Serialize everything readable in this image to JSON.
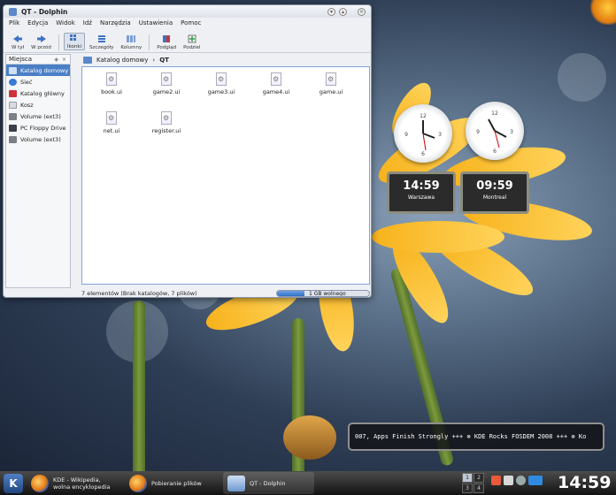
{
  "window": {
    "title": "QT - Dolphin",
    "menu": [
      "Plik",
      "Edycja",
      "Widok",
      "Idź",
      "Narzędzia",
      "Ustawienia",
      "Pomoc"
    ],
    "toolbar": [
      {
        "label": "W tył"
      },
      {
        "label": "W przód"
      },
      {
        "label": "Ikonki"
      },
      {
        "label": "Szczegóły"
      },
      {
        "label": "Kolumny"
      },
      {
        "label": "Podgląd"
      },
      {
        "label": "Podziel"
      }
    ],
    "sidebar": {
      "title": "Miejsca",
      "items": [
        "Katalog domowy",
        "Sieć",
        "Katalog główny",
        "Kosz",
        "Volume (ext3)",
        "PC Floppy Drive",
        "Volume (ext3)"
      ]
    },
    "breadcrumb": {
      "root": "Katalog domowy",
      "separator": "›",
      "current": "QT"
    },
    "files": [
      "book.ui",
      "game2.ui",
      "game3.ui",
      "game4.ui",
      "game.ui",
      "net.ui",
      "register.ui"
    ],
    "status": {
      "text": "7 elementów (Brak katalogów, 7 plików)",
      "disk_label": "1 GB wolnego",
      "disk_used_fraction": 0.3
    }
  },
  "clocks": {
    "digital": [
      {
        "time": "14:59",
        "city": "Warszawa"
      },
      {
        "time": "09:59",
        "city": "Montreal"
      }
    ]
  },
  "ticker": {
    "text": "007, Apps Finish Strongly +++ ⊗ KDE Rocks FOSDEM 2008 +++ ⊗ Ko"
  },
  "taskbar": {
    "tasks": [
      {
        "label": "KDE - Wikipedia, wolna encyklopedia"
      },
      {
        "label": "Pobieranie plików"
      },
      {
        "label": "QT - Dolphin"
      }
    ],
    "pager": [
      "1",
      "2",
      "3",
      "4"
    ],
    "clock": "14:59"
  },
  "colors": {
    "accent": "#4a7fc6",
    "panel": "#121212",
    "flower": "#f7b21c"
  }
}
